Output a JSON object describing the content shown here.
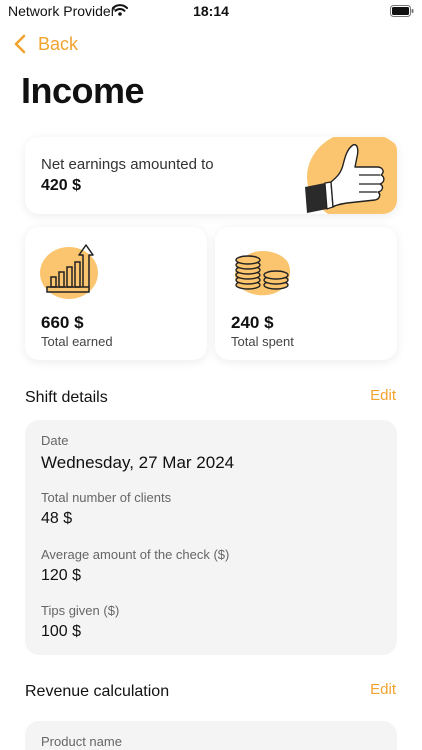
{
  "status": {
    "provider": "Network Provider",
    "time": "18:14"
  },
  "nav": {
    "back_label": "Back"
  },
  "page": {
    "title": "Income"
  },
  "net": {
    "label": "Net earnings amounted to",
    "value": "420 $"
  },
  "earned": {
    "value": "660 $",
    "label": "Total earned"
  },
  "spent": {
    "value": "240 $",
    "label": "Total spent"
  },
  "shift": {
    "title": "Shift details",
    "edit_label": "Edit",
    "fields": [
      {
        "label": "Date",
        "value": "Wednesday, 27 Mar 2024"
      },
      {
        "label": "Total number of clients",
        "value": "48 $"
      },
      {
        "label": "Average amount of the check ($)",
        "value": "120 $"
      },
      {
        "label": "Tips given ($)",
        "value": "100 $"
      }
    ]
  },
  "revenue": {
    "title": "Revenue calculation",
    "edit_label": "Edit",
    "first_field_label": "Product name"
  },
  "colors": {
    "accent": "#F2A32E",
    "blob": "#FBC56F",
    "panel": "#F4F4F5"
  },
  "icons": [
    "wifi-icon",
    "battery-icon",
    "chevron-left-icon",
    "thumbs-up-icon",
    "growth-chart-icon",
    "coins-icon"
  ]
}
